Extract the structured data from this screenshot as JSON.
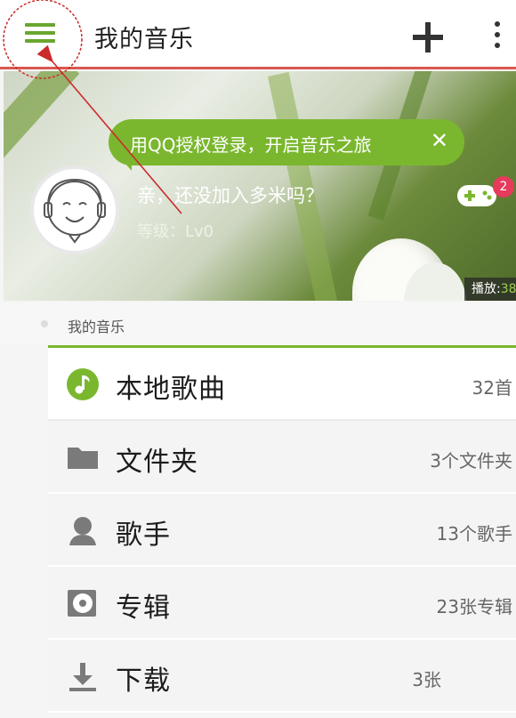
{
  "header": {
    "title": "我的音乐"
  },
  "banner": {
    "login_prompt": "用QQ授权登录，开启音乐之旅",
    "close_glyph": "✕",
    "user_message": "亲，还没加入多米吗？",
    "level": "等级：Lv0",
    "notification_count": "2",
    "play_label": "播放:",
    "play_value": "38"
  },
  "section": {
    "title": "我的音乐"
  },
  "list": [
    {
      "label": "本地歌曲",
      "count": "32首",
      "icon": "music-note-icon"
    },
    {
      "label": "文件夹",
      "count": "3个文件夹",
      "icon": "folder-icon"
    },
    {
      "label": "歌手",
      "count": "13个歌手",
      "icon": "singer-icon"
    },
    {
      "label": "专辑",
      "count": "23张专辑",
      "icon": "album-icon"
    },
    {
      "label": "下载",
      "count": "3张",
      "icon": "download-icon"
    }
  ],
  "colors": {
    "accent": "#7ab72e",
    "divider": "#d9584f",
    "badge": "#e63b5d",
    "annotation": "#cc2b2b"
  }
}
